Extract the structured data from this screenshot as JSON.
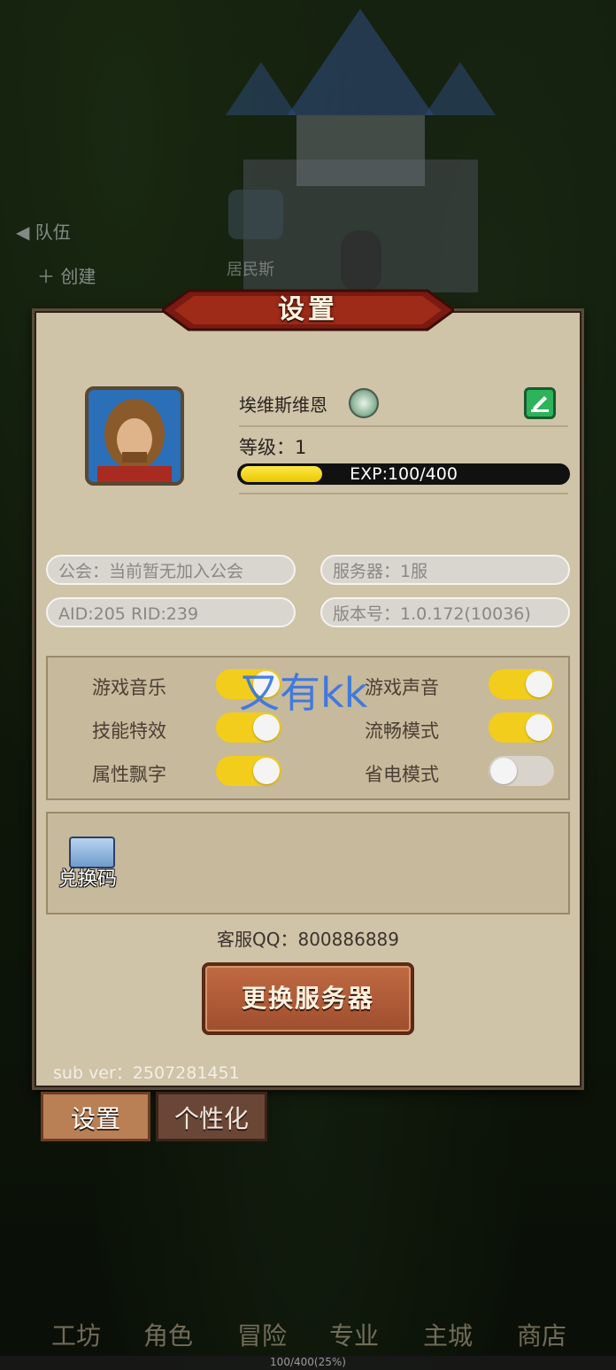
{
  "background": {
    "team_label": "队伍",
    "create_label": "创建",
    "npc_label": "居民斯"
  },
  "panel": {
    "title": "设置",
    "player": {
      "name": "埃维斯维恩",
      "level_label": "等级：1",
      "exp_text": "EXP:100/400",
      "exp_fraction": 0.25
    },
    "info": {
      "guild": "公会：当前暂无加入公会",
      "server": "服务器：1服",
      "ids": "AID:205  RID:239",
      "version": "版本号：1.0.172(10036)"
    },
    "options": [
      {
        "label": "游戏音乐",
        "on": true
      },
      {
        "label": "游戏声音",
        "on": true
      },
      {
        "label": "技能特效",
        "on": true
      },
      {
        "label": "流畅模式",
        "on": true
      },
      {
        "label": "属性飘字",
        "on": true
      },
      {
        "label": "省电模式",
        "on": false
      }
    ],
    "redeem_label": "兑换码",
    "customer_service": "客服QQ：800886889",
    "switch_server_button": "更换服务器",
    "sub_version": "sub ver：2507281451",
    "watermark": "又有kk"
  },
  "tabs": {
    "settings": "设置",
    "personalize": "个性化"
  },
  "bottom_nav": [
    "工坊",
    "角色",
    "冒险",
    "专业",
    "主城",
    "商店"
  ],
  "bottom_progress": "100/400(25%)",
  "colors": {
    "toggle_on": "#f2cd1c",
    "edit_button": "#2db35a",
    "button": "#b05c38"
  }
}
